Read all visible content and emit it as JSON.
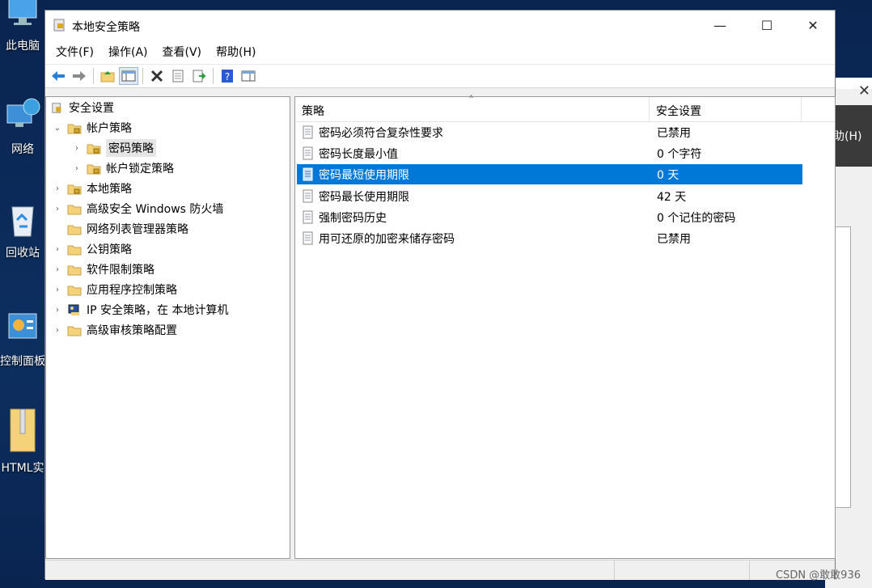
{
  "desktop": {
    "icons": [
      {
        "label": "此电脑",
        "icon": "this-pc-icon"
      },
      {
        "label": "网络",
        "icon": "network-icon"
      },
      {
        "label": "回收站",
        "icon": "recycle-bin-icon"
      },
      {
        "label": "控制面板",
        "icon": "control-panel-icon"
      },
      {
        "label": "HTML实",
        "icon": "zip-folder-icon"
      }
    ]
  },
  "background_window": {
    "menu_fragment": "助(H)",
    "close": "✕"
  },
  "window": {
    "title": "本地安全策略",
    "controls": {
      "minimize": "—",
      "maximize": "☐",
      "close": "✕"
    },
    "menu": [
      "文件(F)",
      "操作(A)",
      "查看(V)",
      "帮助(H)"
    ],
    "toolbar": [
      "back-icon",
      "forward-icon",
      "up-folder-icon",
      "show-hide-tree-icon",
      "delete-icon",
      "properties-icon",
      "export-icon",
      "help-icon",
      "view-icon"
    ]
  },
  "tree": {
    "root": "安全设置",
    "nodes": [
      {
        "label": "帐户策略",
        "expanded": true
      },
      {
        "label": "密码策略",
        "selected": true
      },
      {
        "label": "帐户锁定策略"
      },
      {
        "label": "本地策略"
      },
      {
        "label": "高级安全 Windows 防火墙"
      },
      {
        "label": "网络列表管理器策略"
      },
      {
        "label": "公钥策略"
      },
      {
        "label": "软件限制策略"
      },
      {
        "label": "应用程序控制策略"
      },
      {
        "label": "IP 安全策略，在 本地计算机"
      },
      {
        "label": "高级审核策略配置"
      }
    ]
  },
  "list": {
    "columns": [
      "策略",
      "安全设置"
    ],
    "sort_indicator": "˄",
    "rows": [
      {
        "policy": "密码必须符合复杂性要求",
        "setting": "已禁用"
      },
      {
        "policy": "密码长度最小值",
        "setting": "0 个字符"
      },
      {
        "policy": "密码最短使用期限",
        "setting": "0 天",
        "selected": true
      },
      {
        "policy": "密码最长使用期限",
        "setting": "42 天"
      },
      {
        "policy": "强制密码历史",
        "setting": "0 个记住的密码"
      },
      {
        "policy": "用可还原的加密来储存密码",
        "setting": "已禁用"
      }
    ]
  },
  "watermark": "CSDN @敢敢936",
  "colors": {
    "selection": "#0078d7",
    "folder": "#f3d27a"
  }
}
